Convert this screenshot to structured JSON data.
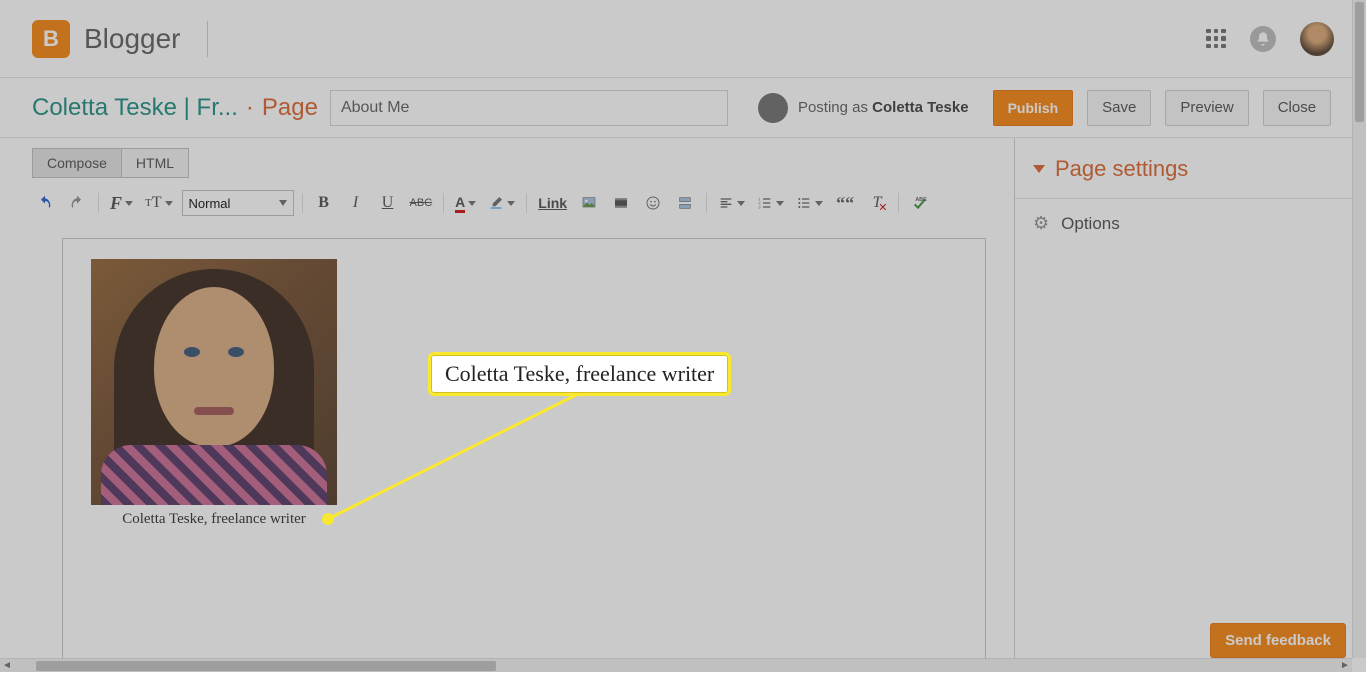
{
  "header": {
    "logo_text": "Blogger",
    "logo_letter": "B"
  },
  "subheader": {
    "blog_title": "Coletta Teske | Fr...",
    "mode_label": "Page",
    "title_input_value": "About Me",
    "posting_as_prefix": "Posting as ",
    "posting_as_name": "Coletta Teske",
    "publish_label": "Publish",
    "save_label": "Save",
    "preview_label": "Preview",
    "close_label": "Close"
  },
  "tabs": {
    "compose": "Compose",
    "html": "HTML"
  },
  "toolbar": {
    "format_value": "Normal",
    "link_label": "Link"
  },
  "editor": {
    "caption": "Coletta Teske, freelance writer"
  },
  "callout": {
    "text": "Coletta Teske, freelance writer"
  },
  "right_panel": {
    "title": "Page settings",
    "options": "Options"
  },
  "feedback": {
    "label": "Send feedback"
  }
}
